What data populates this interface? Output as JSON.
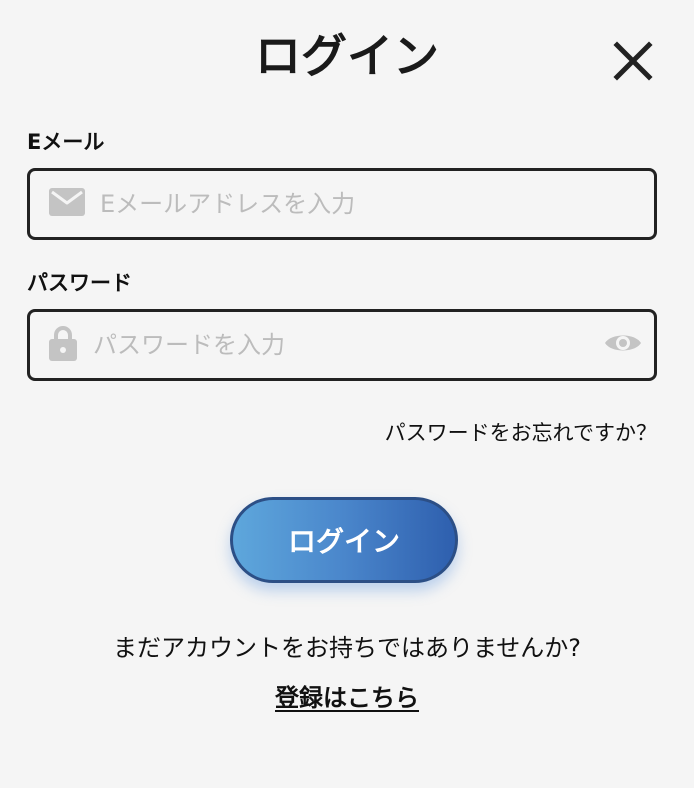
{
  "header": {
    "title": "ログイン",
    "close_icon": "close-icon"
  },
  "email": {
    "label": "Eメール",
    "placeholder": "Eメールアドレスを入力",
    "value": "",
    "icon": "envelope-icon"
  },
  "password": {
    "label": "パスワード",
    "placeholder": "パスワードを入力",
    "value": "",
    "icon": "lock-icon",
    "toggle_icon": "eye-icon"
  },
  "forgot_password": {
    "text": "パスワードをお忘れですか？"
  },
  "login_button": {
    "label": "ログイン"
  },
  "footer": {
    "no_account_text": "まだアカウントをお持ちではありませんか?",
    "register_link": "登録はこちら"
  },
  "colors": {
    "background": "#f5f5f5",
    "button_gradient_start": "#5ea7dc",
    "button_gradient_end": "#2e5fae",
    "input_border": "#222222",
    "placeholder": "#bcbcbc",
    "icon_gray": "#c4c4c4"
  }
}
